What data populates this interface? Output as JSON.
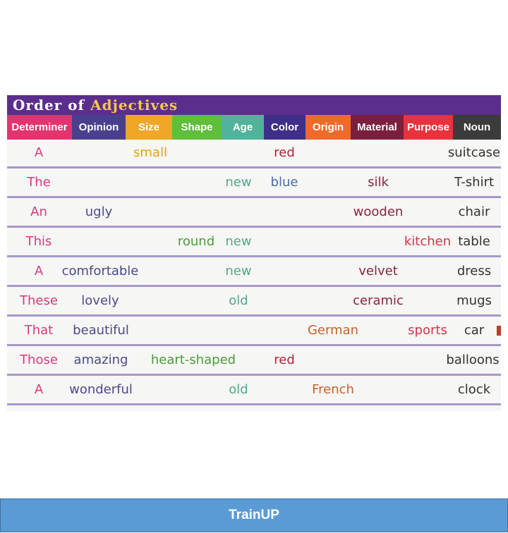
{
  "title": {
    "part1": "Order of",
    "part2": "Adjectives"
  },
  "columns": [
    {
      "label": "Determiner",
      "color": "#e5336f"
    },
    {
      "label": "Opinion",
      "color": "#4a3f8f"
    },
    {
      "label": "Size",
      "color": "#f0a627"
    },
    {
      "label": "Shape",
      "color": "#5dbf3a"
    },
    {
      "label": "Age",
      "color": "#4fb49a"
    },
    {
      "label": "Color",
      "color": "#3f2f8a"
    },
    {
      "label": "Origin",
      "color": "#ef6a2a"
    },
    {
      "label": "Material",
      "color": "#7b1f3f"
    },
    {
      "label": "Purpose",
      "color": "#e8333d"
    },
    {
      "label": "Noun",
      "color": "#3b3b3b"
    }
  ],
  "cell_colors": {
    "Determiner": "#d63a7e",
    "Opinion": "#4a4a8c",
    "Size": "#e3a21a",
    "Shape": "#4a9a3a",
    "Age": "#52a88c",
    "Color": "#b0233a",
    "Color_blue": "#4a6aa8",
    "Origin": "#c9602a",
    "Material": "#8a2340",
    "Purpose": "#d0344a",
    "Noun": "#333333"
  },
  "rows": [
    {
      "Determiner": "A",
      "Size": "small",
      "Color": "red",
      "Noun": "suitcase"
    },
    {
      "Determiner": "The",
      "Age": "new",
      "Color": "blue",
      "Material": "silk",
      "Noun": "T-shirt"
    },
    {
      "Determiner": "An",
      "Opinion": "ugly",
      "Material": "wooden",
      "Noun": "chair"
    },
    {
      "Determiner": "This",
      "Shape": "round",
      "Age": "new",
      "Purpose": "kitchen",
      "Noun": "table"
    },
    {
      "Determiner": "A",
      "Opinion": "comfortable",
      "Age": "new",
      "Material": "velvet",
      "Noun": "dress"
    },
    {
      "Determiner": "These",
      "Opinion": "lovely",
      "Age": "old",
      "Material": "ceramic",
      "Noun": "mugs"
    },
    {
      "Determiner": "That",
      "Opinion": "beautiful",
      "Origin": "German",
      "Purpose": "sports",
      "Noun": "car"
    },
    {
      "Determiner": "Those",
      "Opinion": "amazing",
      "Shape": "heart-shaped",
      "Color": "red",
      "Noun": "balloons"
    },
    {
      "Determiner": "A",
      "Opinion": "wonderful",
      "Age": "old",
      "Origin": "French",
      "Noun": "clock"
    }
  ],
  "footer": {
    "text": "TrainUP"
  }
}
